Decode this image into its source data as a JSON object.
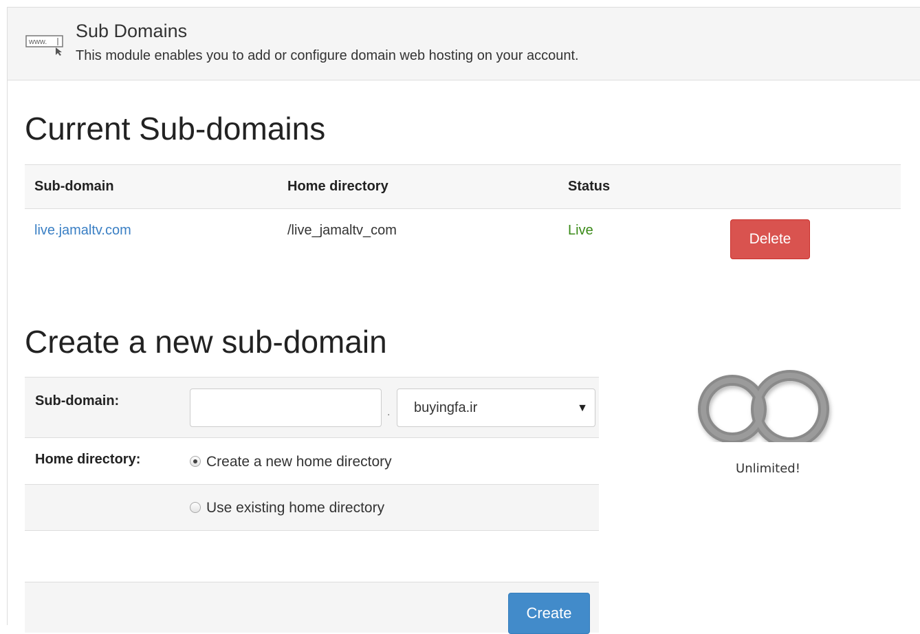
{
  "module": {
    "title": "Sub Domains",
    "description": "This module enables you to add or configure domain web hosting on your account.",
    "icon": "www-cursor-icon"
  },
  "current": {
    "heading": "Current Sub-domains",
    "columns": [
      "Sub-domain",
      "Home directory",
      "Status"
    ],
    "rows": [
      {
        "subdomain": "live.jamaltv.com",
        "home_directory": "/live_jamaltv_com",
        "status": "Live",
        "action": "Delete"
      }
    ]
  },
  "create": {
    "heading": "Create a new sub-domain",
    "subdomain_label": "Sub-domain:",
    "subdomain_value": "",
    "separator": ".",
    "domain_selected": "buyingfa.ir",
    "home_dir_label": "Home directory:",
    "radio_new": "Create a new home directory",
    "radio_existing": "Use existing home directory",
    "create_button": "Create"
  },
  "quota": {
    "label": "Unlimited!",
    "icon": "infinity-icon"
  },
  "colors": {
    "link": "#3a7fc4",
    "live": "#3a8a18",
    "danger": "#d9534f",
    "primary": "#428bca"
  }
}
